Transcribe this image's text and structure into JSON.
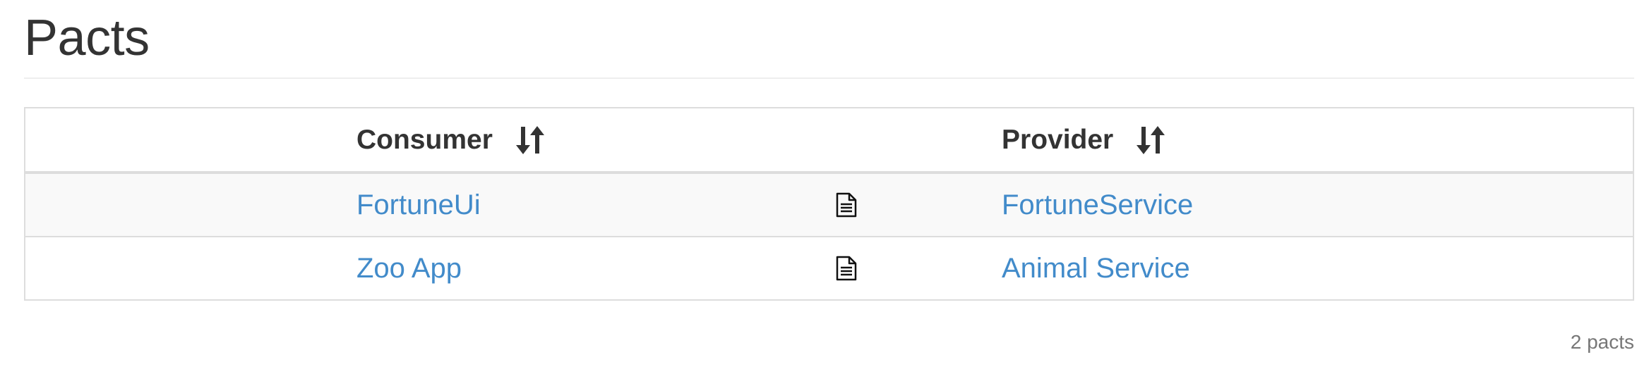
{
  "page": {
    "title": "Pacts",
    "count_label": "2 pacts"
  },
  "table": {
    "headers": {
      "consumer": "Consumer",
      "provider": "Provider"
    },
    "sort_icon": "sort-up-down-icon",
    "doc_icon": "document-icon",
    "rows": [
      {
        "consumer": "FortuneUi",
        "provider": "FortuneService"
      },
      {
        "consumer": "Zoo App",
        "provider": "Animal Service"
      }
    ]
  },
  "colors": {
    "link": "#428bca",
    "text": "#333333",
    "muted": "#777777",
    "border": "#dddddd",
    "stripe": "#f9f9f9"
  }
}
